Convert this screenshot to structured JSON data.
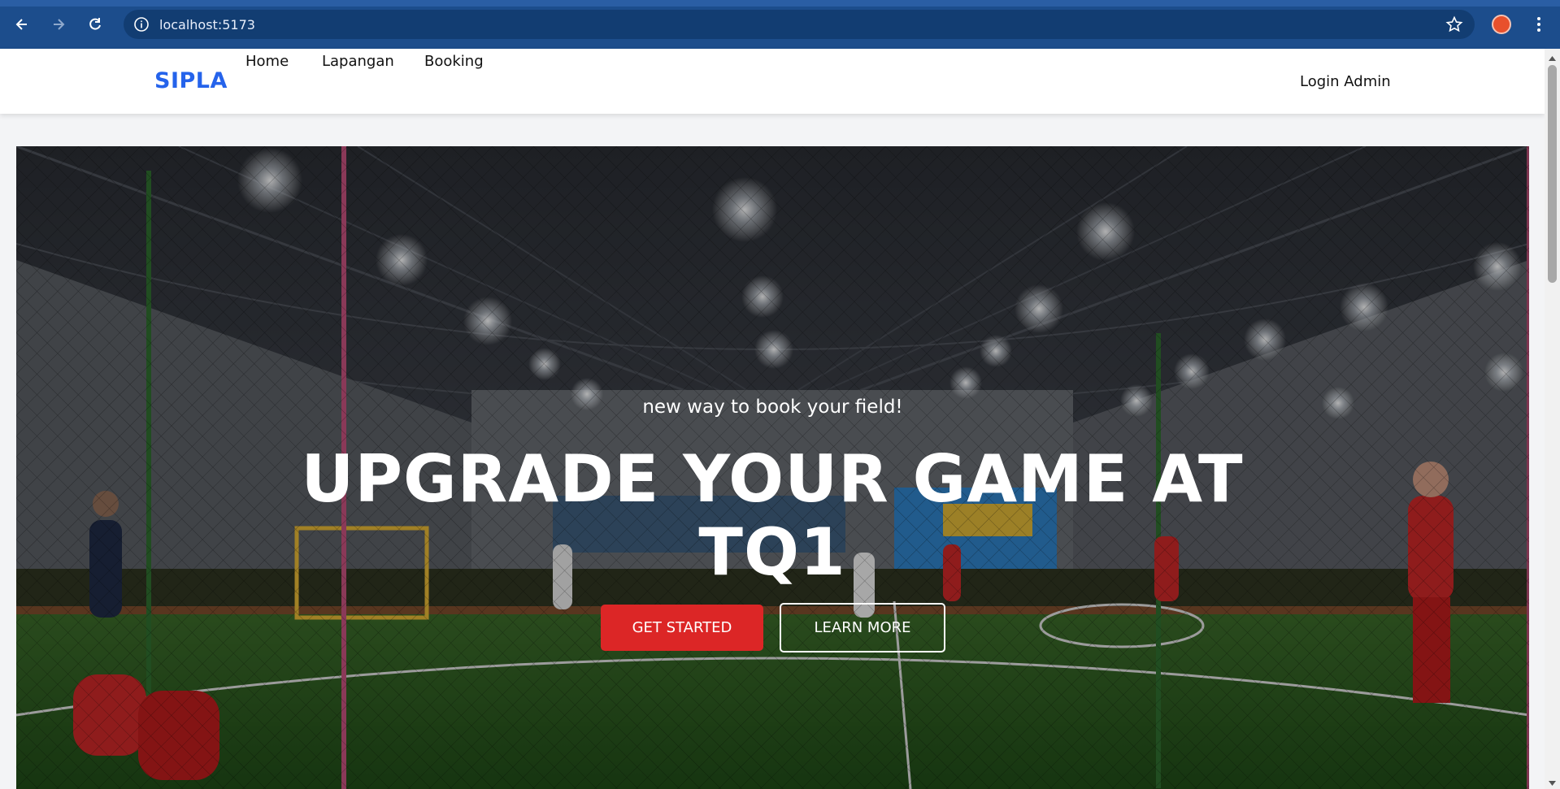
{
  "browser": {
    "url": "localhost:5173"
  },
  "header": {
    "logo": "SIPLA",
    "nav": [
      {
        "label": "Home"
      },
      {
        "label": "Lapangan"
      },
      {
        "label": "Booking"
      }
    ],
    "login_label": "Login Admin"
  },
  "hero": {
    "tagline": "new way to book your field!",
    "headline": "UPGRADE YOUR GAME AT TQ1",
    "primary_button": "GET STARTED",
    "secondary_button": "LEARN MORE"
  },
  "icons": {
    "back": "back-arrow-icon",
    "forward": "forward-arrow-icon",
    "reload": "reload-icon",
    "site_info": "info-icon",
    "bookmark": "star-icon",
    "profile": "avatar",
    "menu": "kebab-menu-icon"
  },
  "colors": {
    "browser_bar": "#1c4d8c",
    "brand": "#2563eb",
    "primary_button": "#dc2626"
  }
}
